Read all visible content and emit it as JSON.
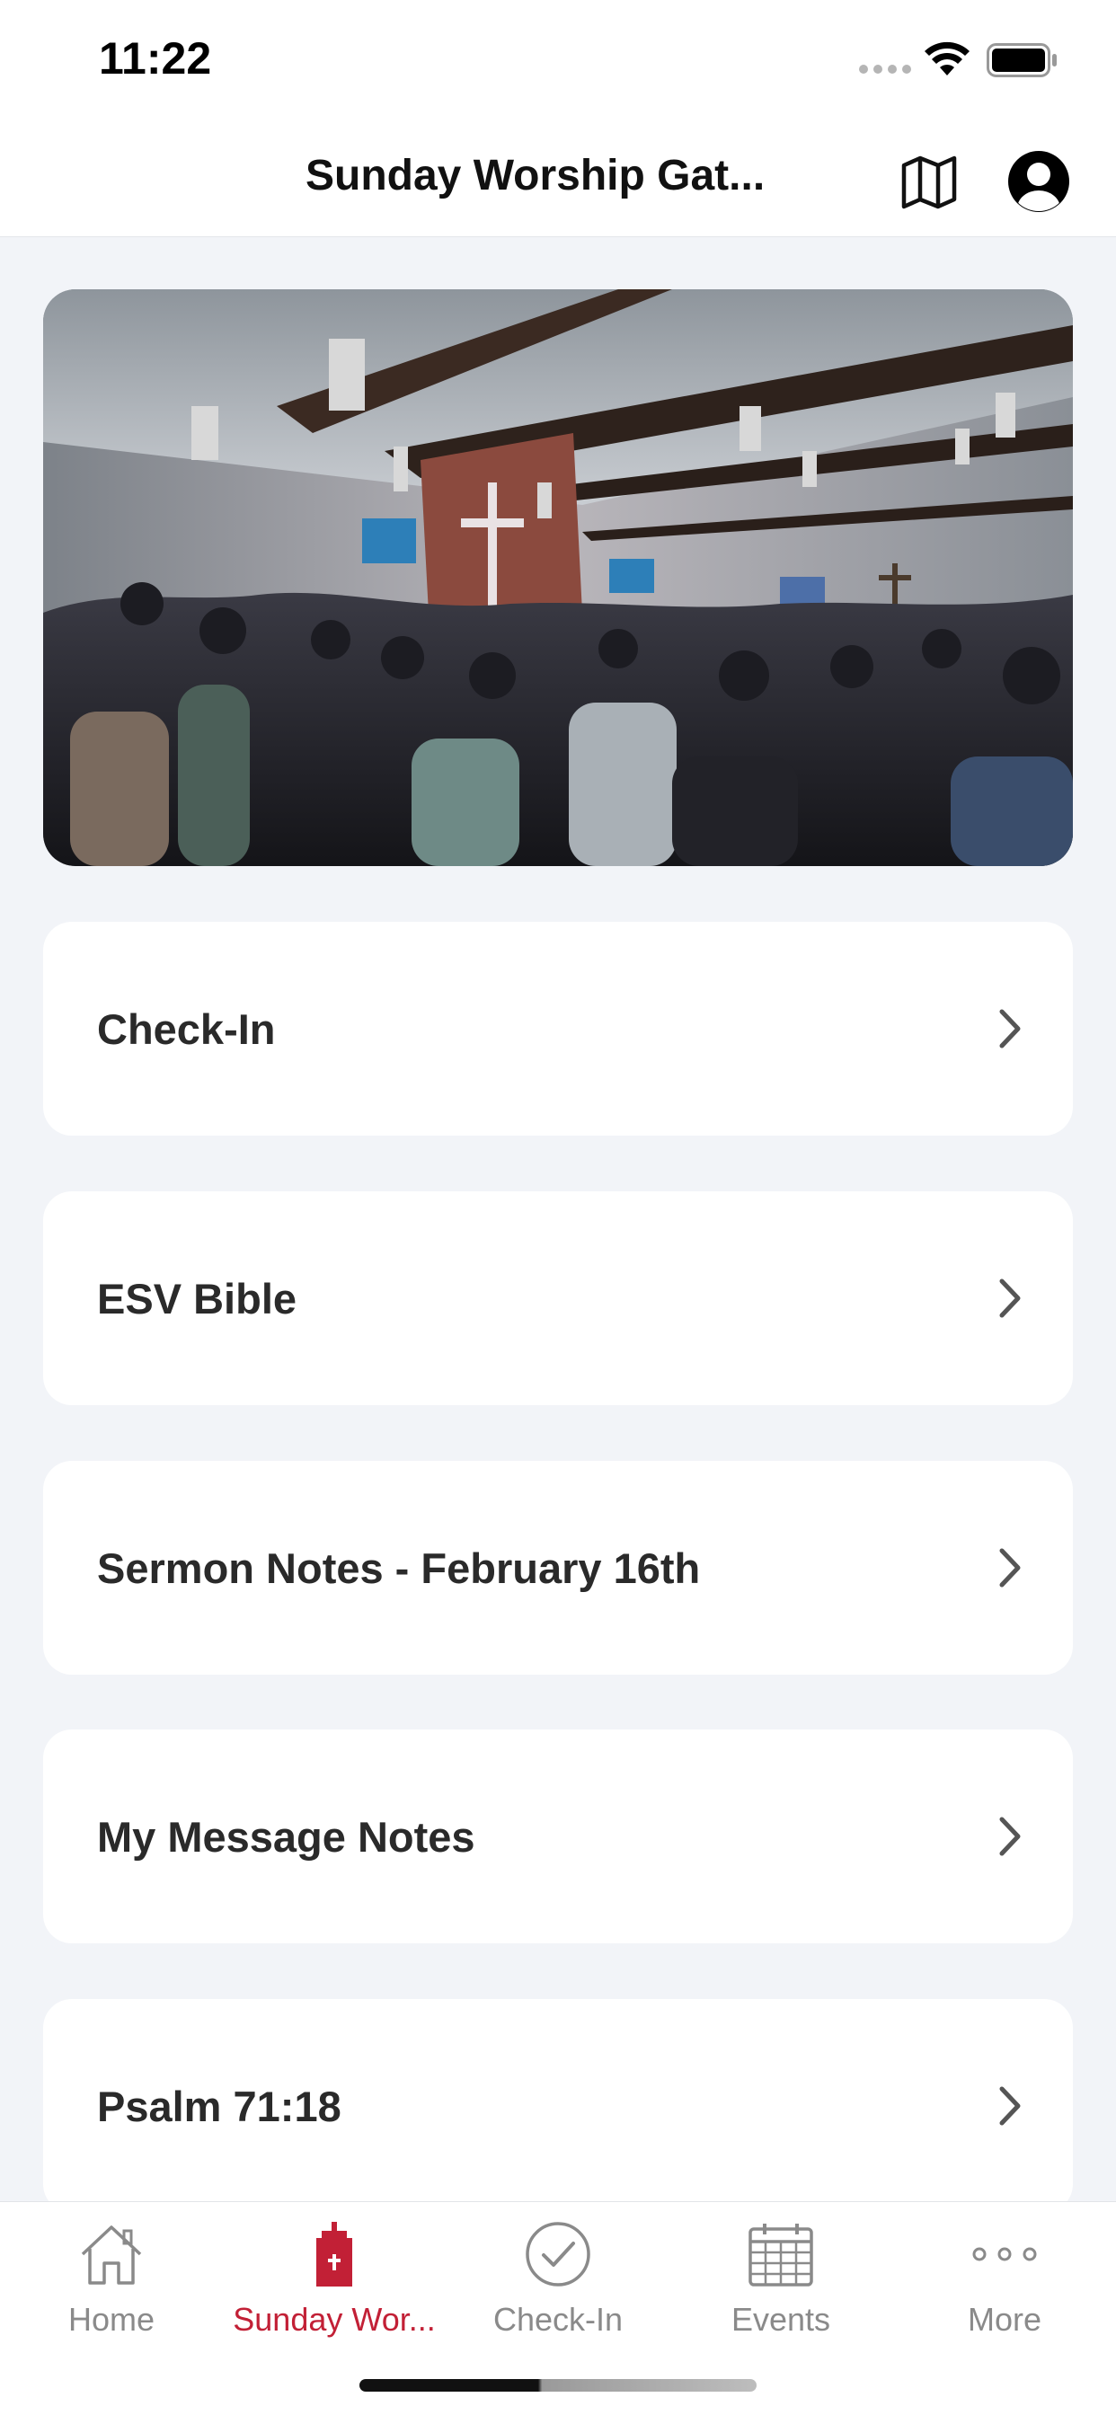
{
  "status_bar": {
    "time": "11:22"
  },
  "header": {
    "title": "Sunday Worship Gat...",
    "map_icon": "map-icon",
    "profile_icon": "profile-icon"
  },
  "hero": {
    "image": "worship-service-photo"
  },
  "menu": {
    "items": [
      {
        "label": "Check-In"
      },
      {
        "label": "ESV Bible"
      },
      {
        "label": "Sermon Notes - February 16th"
      },
      {
        "label": "My Message Notes"
      },
      {
        "label": "Psalm 71:18"
      }
    ]
  },
  "tab_bar": {
    "active_color": "#c22036",
    "inactive_color": "#8a8a8a",
    "tabs": [
      {
        "label": "Home",
        "icon": "home-icon"
      },
      {
        "label": "Sunday Wor...",
        "icon": "church-icon",
        "active": true
      },
      {
        "label": "Check-In",
        "icon": "check-circle-icon"
      },
      {
        "label": "Events",
        "icon": "calendar-icon"
      },
      {
        "label": "More",
        "icon": "more-icon"
      }
    ]
  }
}
